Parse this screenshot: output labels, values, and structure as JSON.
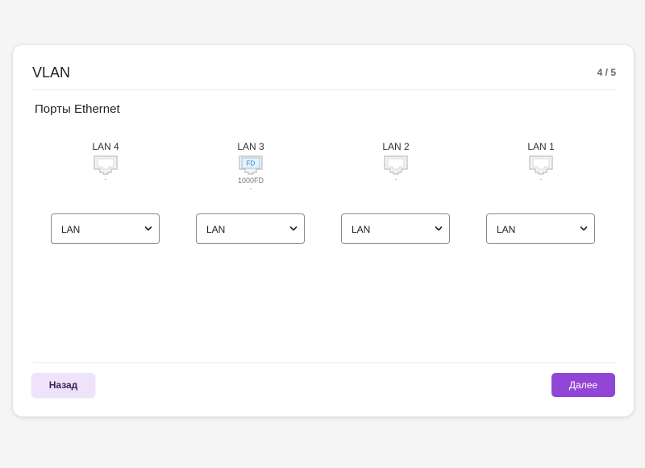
{
  "header": {
    "title": "VLAN",
    "step": "4 / 5"
  },
  "section": {
    "title": "Порты Ethernet"
  },
  "ports": [
    {
      "name": "LAN 4",
      "icon": "ethernet-port-icon",
      "badge": "",
      "speed": "",
      "status": "-",
      "mode": "LAN"
    },
    {
      "name": "LAN 3",
      "icon": "ethernet-port-active-icon",
      "badge": "FD",
      "speed": "1000FD",
      "status": "-",
      "mode": "LAN"
    },
    {
      "name": "LAN 2",
      "icon": "ethernet-port-icon",
      "badge": "",
      "speed": "",
      "status": "-",
      "mode": "LAN"
    },
    {
      "name": "LAN 1",
      "icon": "ethernet-port-icon",
      "badge": "",
      "speed": "",
      "status": "-",
      "mode": "LAN"
    }
  ],
  "footer": {
    "back_label": "Назад",
    "next_label": "Далее"
  },
  "colors": {
    "accent": "#9146d6",
    "back_bg": "#efe3fb",
    "port_active_fill": "#e3f2fc",
    "port_active_border": "#7fb8e0"
  }
}
